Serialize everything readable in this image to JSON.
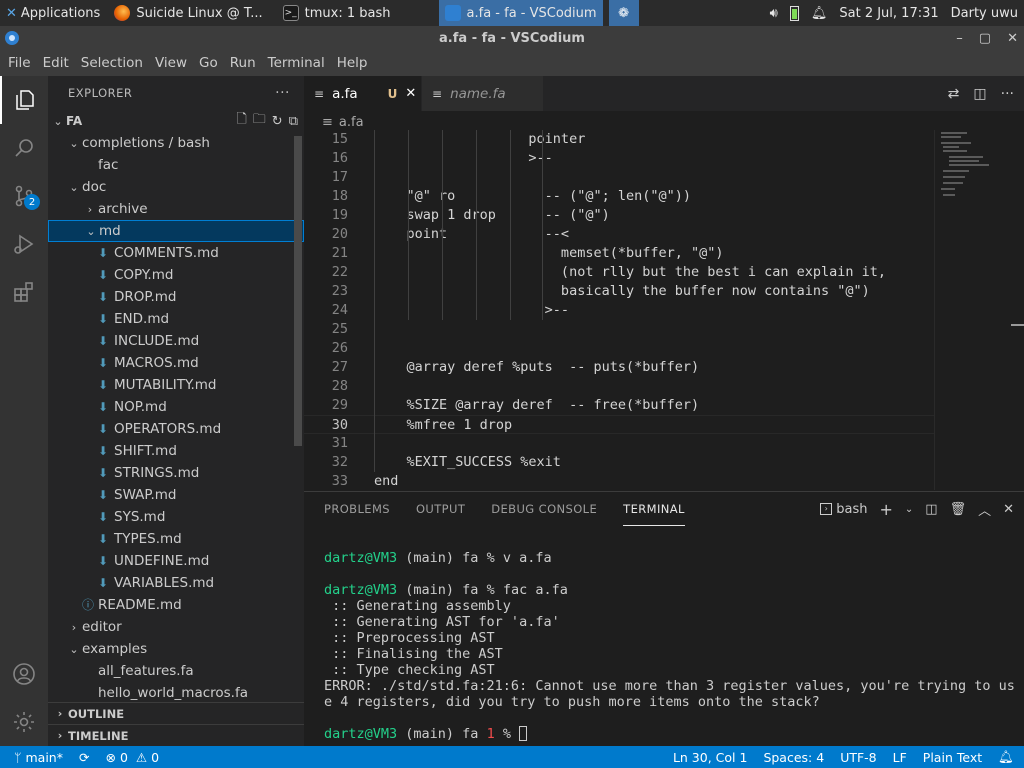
{
  "taskbar": {
    "applications": "Applications",
    "apps": [
      {
        "label": "Suicide Linux @ T..."
      },
      {
        "label": "tmux: 1 bash"
      },
      {
        "label": "a.fa - fa - VSCodium"
      }
    ],
    "datetime": "Sat  2 Jul, 17:31",
    "user": "Darty uwu"
  },
  "window": {
    "title": "a.fa - fa - VSCodium"
  },
  "menu": [
    "File",
    "Edit",
    "Selection",
    "View",
    "Go",
    "Run",
    "Terminal",
    "Help"
  ],
  "activity": {
    "scm_badge": "2"
  },
  "explorer": {
    "header": "EXPLORER",
    "root": "FA",
    "tree": [
      {
        "label": "completions / bash",
        "kind": "folder-open",
        "depth": 1
      },
      {
        "label": "fac",
        "kind": "file",
        "depth": 2
      },
      {
        "label": "doc",
        "kind": "folder-open",
        "depth": 1
      },
      {
        "label": "archive",
        "kind": "folder",
        "depth": 2
      },
      {
        "label": "md",
        "kind": "folder-open",
        "depth": 2,
        "selected": true
      },
      {
        "label": "COMMENTS.md",
        "kind": "md",
        "depth": 3
      },
      {
        "label": "COPY.md",
        "kind": "md",
        "depth": 3
      },
      {
        "label": "DROP.md",
        "kind": "md",
        "depth": 3
      },
      {
        "label": "END.md",
        "kind": "md",
        "depth": 3
      },
      {
        "label": "INCLUDE.md",
        "kind": "md",
        "depth": 3
      },
      {
        "label": "MACROS.md",
        "kind": "md",
        "depth": 3
      },
      {
        "label": "MUTABILITY.md",
        "kind": "md",
        "depth": 3
      },
      {
        "label": "NOP.md",
        "kind": "md",
        "depth": 3
      },
      {
        "label": "OPERATORS.md",
        "kind": "md",
        "depth": 3
      },
      {
        "label": "SHIFT.md",
        "kind": "md",
        "depth": 3
      },
      {
        "label": "STRINGS.md",
        "kind": "md",
        "depth": 3
      },
      {
        "label": "SWAP.md",
        "kind": "md",
        "depth": 3
      },
      {
        "label": "SYS.md",
        "kind": "md",
        "depth": 3
      },
      {
        "label": "TYPES.md",
        "kind": "md",
        "depth": 3
      },
      {
        "label": "UNDEFINE.md",
        "kind": "md",
        "depth": 3
      },
      {
        "label": "VARIABLES.md",
        "kind": "md",
        "depth": 3
      },
      {
        "label": "README.md",
        "kind": "info",
        "depth": 2
      },
      {
        "label": "editor",
        "kind": "folder",
        "depth": 1
      },
      {
        "label": "examples",
        "kind": "folder-open",
        "depth": 1
      },
      {
        "label": "all_features.fa",
        "kind": "fa",
        "depth": 2
      },
      {
        "label": "hello_world_macros.fa",
        "kind": "fa",
        "depth": 2
      }
    ],
    "outline": "OUTLINE",
    "timeline": "TIMELINE"
  },
  "tabs": [
    {
      "label": "a.fa",
      "modified": "U",
      "active": true
    },
    {
      "label": "name.fa",
      "active": false
    }
  ],
  "breadcrumb": "a.fa",
  "code": [
    {
      "n": "15",
      "text": "                   pointer"
    },
    {
      "n": "16",
      "text": "                   >--"
    },
    {
      "n": "17",
      "text": ""
    },
    {
      "n": "18",
      "text": "    \"@\" ro           -- (\"@\"; len(\"@\"))"
    },
    {
      "n": "19",
      "text": "    swap 1 drop      -- (\"@\")"
    },
    {
      "n": "20",
      "text": "    point            --<"
    },
    {
      "n": "21",
      "text": "                       memset(*buffer, \"@\")"
    },
    {
      "n": "22",
      "text": "                       (not rlly but the best i can explain it,"
    },
    {
      "n": "23",
      "text": "                       basically the buffer now contains \"@\")"
    },
    {
      "n": "24",
      "text": "                     >--"
    },
    {
      "n": "25",
      "text": ""
    },
    {
      "n": "26",
      "text": ""
    },
    {
      "n": "27",
      "text": "    @array deref %puts  -- puts(*buffer)"
    },
    {
      "n": "28",
      "text": ""
    },
    {
      "n": "29",
      "text": "    %SIZE @array deref  -- free(*buffer)"
    },
    {
      "n": "30",
      "text": "    %mfree 1 drop"
    },
    {
      "n": "31",
      "text": ""
    },
    {
      "n": "32",
      "text": "    %EXIT_SUCCESS %exit"
    },
    {
      "n": "33",
      "text": "end"
    }
  ],
  "current_line": "30",
  "panel": {
    "tabs": [
      "PROBLEMS",
      "OUTPUT",
      "DEBUG CONSOLE",
      "TERMINAL"
    ],
    "active_tab": "TERMINAL",
    "shell": "bash"
  },
  "terminal": {
    "prompt_user": "dartz@VM3",
    "prompt_rest": " (main) fa ",
    "cmd1": "% v a.fa",
    "cmd2": "% fac a.fa",
    "output": [
      " :: Generating assembly",
      " :: Generating AST for 'a.fa'",
      " :: Preprocessing AST",
      " :: Finalising the AST",
      " :: Type checking AST",
      "ERROR: ./std/std.fa:21:6: Cannot use more than 3 register values, you're trying to us",
      "e 4 registers, did you try to push more items onto the stack?"
    ],
    "exit_code": "1",
    "last_prompt_tail": " %"
  },
  "status": {
    "branch": "main*",
    "errors": "0",
    "warnings": "0",
    "position": "Ln 30, Col 1",
    "spaces": "Spaces: 4",
    "encoding": "UTF-8",
    "eol": "LF",
    "language": "Plain Text"
  },
  "colors": {
    "accent": "#007acc",
    "terminal_green": "#23d18b",
    "terminal_red": "#f14c4c",
    "md_icon": "#519aba"
  }
}
